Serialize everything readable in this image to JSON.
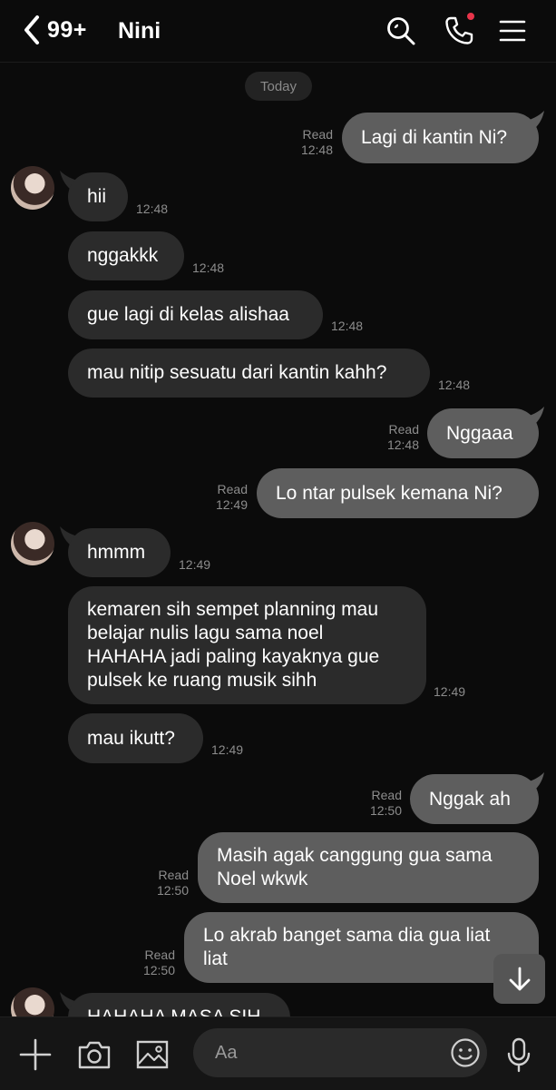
{
  "header": {
    "unread_count": "99+",
    "chat_name": "Nini"
  },
  "date_divider": "Today",
  "messages": [
    {
      "dir": "out",
      "text": "Lagi di kantin Ni?",
      "status": "Read",
      "time": "12:48"
    },
    {
      "dir": "in",
      "text": "hii",
      "time": "12:48"
    },
    {
      "dir": "in",
      "text": "nggakkk",
      "time": "12:48"
    },
    {
      "dir": "in",
      "text": "gue lagi di kelas alishaa",
      "time": "12:48"
    },
    {
      "dir": "in",
      "text": "mau nitip sesuatu dari kantin kahh?",
      "time": "12:48"
    },
    {
      "dir": "out",
      "text": "Nggaaa",
      "status": "Read",
      "time": "12:48"
    },
    {
      "dir": "out",
      "text": "Lo ntar pulsek kemana Ni?",
      "status": "Read",
      "time": "12:49"
    },
    {
      "dir": "in",
      "text": "hmmm",
      "time": "12:49"
    },
    {
      "dir": "in",
      "text": "kemaren sih sempet planning mau\nbelajar nulis lagu sama noel\nHAHAHA jadi paling kayaknya gue\npulsek ke ruang musik sihh",
      "time": "12:49"
    },
    {
      "dir": "in",
      "text": "mau ikutt?",
      "time": "12:49"
    },
    {
      "dir": "out",
      "text": "Nggak ah",
      "status": "Read",
      "time": "12:50"
    },
    {
      "dir": "out",
      "text": "Masih agak canggung gua sama\nNoel wkwk",
      "status": "Read",
      "time": "12:50"
    },
    {
      "dir": "out",
      "text": "Lo akrab banget sama dia gua liat\nliat",
      "status": "Read",
      "time": "12:50"
    },
    {
      "dir": "in",
      "text": "HAHAHA MASA SIH"
    }
  ],
  "input": {
    "placeholder": "Aa"
  },
  "icons": {
    "back": "chevron-left-icon",
    "search": "search-icon",
    "call": "phone-icon",
    "menu": "hamburger-menu-icon",
    "scroll": "arrow-down-icon",
    "add": "plus-icon",
    "camera": "camera-icon",
    "gallery": "image-icon",
    "emoji": "emoji-icon",
    "mic": "microphone-icon"
  },
  "colors": {
    "background": "#0b0b0b",
    "incoming_bubble": "#2b2b2b",
    "outgoing_bubble": "#5e5e5e",
    "notification_dot": "#e8344a"
  }
}
